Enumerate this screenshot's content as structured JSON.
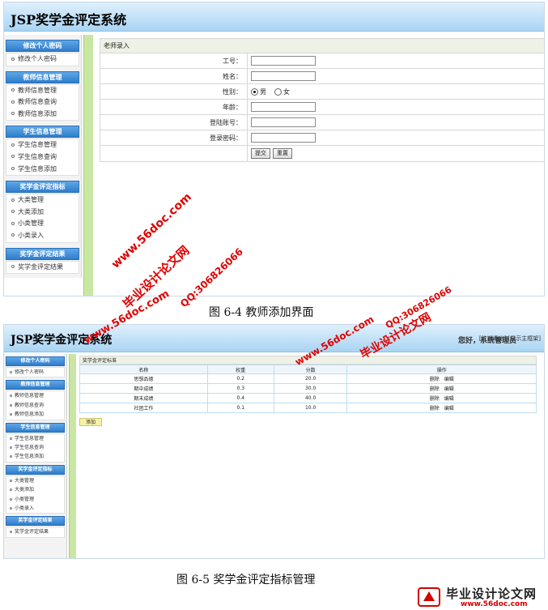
{
  "screen1": {
    "system_title": "JSP奖学金评定系统",
    "sidebar": [
      {
        "title": "修改个人密码",
        "items": [
          "修改个人密码"
        ]
      },
      {
        "title": "教师信息管理",
        "items": [
          "教师信息管理",
          "教师信息查询",
          "教师信息添加"
        ]
      },
      {
        "title": "学生信息管理",
        "items": [
          "学生信息管理",
          "学生信息查询",
          "学生信息添加"
        ]
      },
      {
        "title": "奖学金评定指标",
        "items": [
          "大类管理",
          "大类添加",
          "小类管理",
          "小类录入"
        ]
      },
      {
        "title": "奖学金评定结果",
        "items": [
          "奖学金评定结果"
        ]
      }
    ],
    "form": {
      "title": "老师录入",
      "labels": {
        "gonghao": "工号：",
        "name": "姓名：",
        "gender": "性别：",
        "age": "年龄：",
        "login": "登陆账号：",
        "password": "登录密码："
      },
      "gender_options": [
        "男",
        "女"
      ],
      "gender_selected": "男",
      "submit_label": "提交",
      "reset_label": "重置"
    }
  },
  "caption1": "图  6-4  教师添加界面",
  "screen2": {
    "system_title": "JSP奖学金评定系统",
    "user_greeting": "您好，系统管理员",
    "top_links": "[注销退出] [显示主框架]",
    "sidebar": [
      {
        "title": "修改个人密码",
        "items": [
          "修改个人密码"
        ]
      },
      {
        "title": "教师信息管理",
        "items": [
          "教师信息管理",
          "教师信息查询",
          "教师信息添加"
        ]
      },
      {
        "title": "学生信息管理",
        "items": [
          "学生信息管理",
          "学生信息查询",
          "学生信息添加"
        ]
      },
      {
        "title": "奖学金评定指标",
        "items": [
          "大类管理",
          "大类添加",
          "小类管理",
          "小类录入"
        ]
      },
      {
        "title": "奖学金评定结果",
        "items": [
          "奖学金评定结果"
        ]
      }
    ],
    "table": {
      "title": "奖学金评定标准",
      "headers": [
        "名称",
        "权重",
        "分数",
        "操作"
      ],
      "rows": [
        {
          "name": "思想品德",
          "weight": "0.2",
          "score": "20.0"
        },
        {
          "name": "期中成绩",
          "weight": "0.3",
          "score": "30.0"
        },
        {
          "name": "期末成绩",
          "weight": "0.4",
          "score": "40.0"
        },
        {
          "name": "社团工作",
          "weight": "0.1",
          "score": "10.0"
        }
      ],
      "op_delete": "删除",
      "op_edit": "编辑",
      "add_label": "添加"
    }
  },
  "caption2": "图  6-5  奖学金评定指标管理",
  "watermarks": {
    "site_name": "毕业设计论文网",
    "qq": "QQ:306826066",
    "url": "www.56doc.com"
  },
  "colors": {
    "header_blue": "#a9d4f3",
    "section_blue": "#2f7dcb",
    "green_bar": "#c9e7a3",
    "watermark_red": "#e00000"
  }
}
